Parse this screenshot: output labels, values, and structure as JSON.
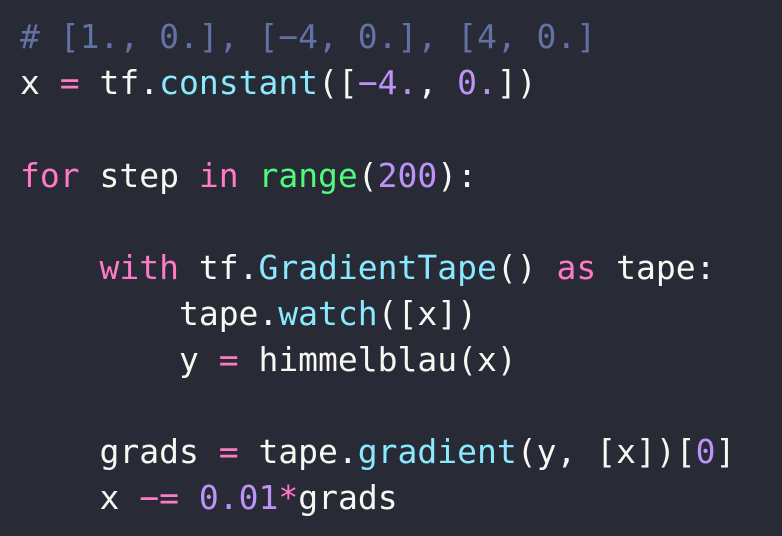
{
  "code": {
    "colors": {
      "background": "#282a36",
      "text": "#f8f8f2",
      "comment": "#6272a4",
      "keyword": "#ff79c6",
      "function": "#8be9fd",
      "builtin": "#50fa7b",
      "number": "#bd93f9"
    },
    "line1": {
      "comment": "# [1., 0.], [−4, 0.], [4, 0.]"
    },
    "line2": {
      "var": "x ",
      "op": "=",
      "obj": " tf.",
      "fn": "constant",
      "open": "([",
      "neg": "−4.",
      "sep": ", ",
      "zero": "0.",
      "close": "])"
    },
    "line4": {
      "kw_for": "for",
      "var": " step ",
      "kw_in": "in",
      "space": " ",
      "builtin": "range",
      "open": "(",
      "num": "200",
      "close": "):"
    },
    "line6": {
      "indent": "    ",
      "kw_with": "with",
      "obj": " tf.",
      "fn": "GradientTape",
      "call": "() ",
      "kw_as": "as",
      "rest": " tape:"
    },
    "line7": {
      "indent": "        ",
      "obj": "tape.",
      "fn": "watch",
      "rest": "([x])"
    },
    "line8": {
      "indent": "        ",
      "var": "y ",
      "op": "=",
      "rest": " himmelblau(x)"
    },
    "line10": {
      "indent": "    ",
      "var": "grads ",
      "op": "=",
      "obj": " tape.",
      "fn": "gradient",
      "args": "(y, [x])[",
      "num": "0",
      "close": "]"
    },
    "line11": {
      "indent": "    ",
      "var": "x ",
      "op": "−=",
      "space": " ",
      "num": "0.01",
      "mul": "*",
      "rest": "grads"
    }
  }
}
